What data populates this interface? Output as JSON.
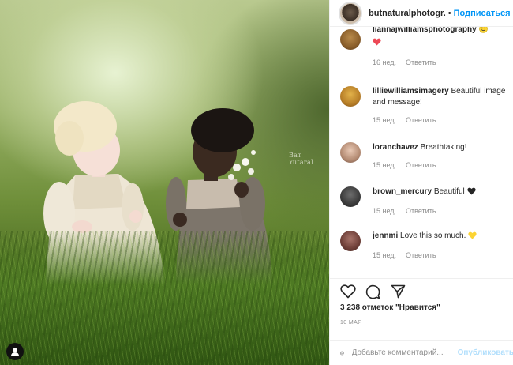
{
  "photo": {
    "watermark": "Ват Yutaral"
  },
  "header": {
    "username": "butnaturalphotogr.",
    "separator": "•",
    "follow_label": "Подписаться"
  },
  "comments": [
    {
      "username": "liannajwilliamsphotography",
      "text": "",
      "time": "16 нед.",
      "reply": "Ответить"
    },
    {
      "username": "lilliewilliamsimagery",
      "text": "Beautiful image and message!",
      "time": "15 нед.",
      "reply": "Ответить"
    },
    {
      "username": "loranchavez",
      "text": "Breathtaking!",
      "time": "15 нед.",
      "reply": "Ответить"
    },
    {
      "username": "brown_mercury",
      "text": "Beautiful",
      "time": "15 нед.",
      "reply": "Ответить"
    },
    {
      "username": "jennmi",
      "text": "Love this so much.",
      "time": "15 нед.",
      "reply": "Ответить"
    }
  ],
  "post": {
    "likes": "3 238 отметок \"Нравится\"",
    "date": "10 МАЯ"
  },
  "composer": {
    "placeholder": "Добавьте комментарий...",
    "publish_label": "Опубликовать"
  },
  "colors": {
    "accent": "#0095f6",
    "heart": "#ed4956",
    "yellow_heart": "#fcd434",
    "muted": "#8e8e8e"
  }
}
